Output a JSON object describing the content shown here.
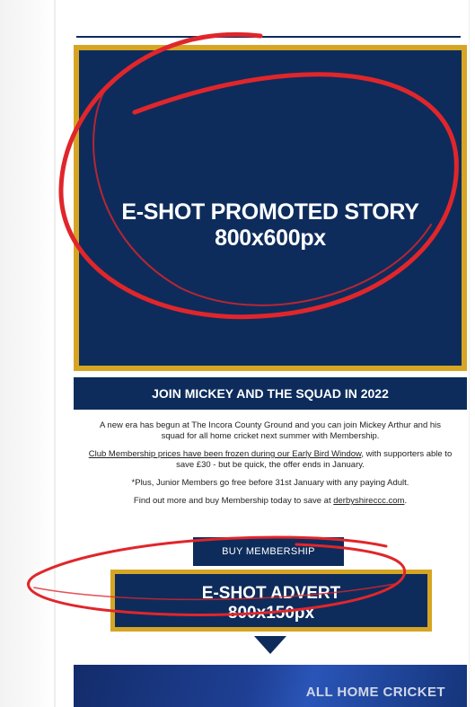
{
  "promo": {
    "line1": "E-SHOT PROMOTED STORY",
    "line2": "800x600px"
  },
  "band": {
    "title": "JOIN MICKEY AND THE SQUAD IN 2022"
  },
  "body": {
    "p1": "A new era has begun at The Incora County Ground and you can join Mickey Arthur and his squad for all home cricket next summer with Membership.",
    "p2_link": "Club Membership prices have been frozen during our Early Bird Window",
    "p2_rest": ", with supporters able to save £30 - but be quick, the offer ends in January.",
    "p3": "*Plus, Junior Members go free before 31st January with any paying Adult.",
    "p4_pre": "Find out more and buy Membership today to save at ",
    "p4_link": "derbyshireccc.com",
    "p4_post": "."
  },
  "buttons": {
    "buy": "BUY MEMBERSHIP"
  },
  "advert": {
    "line1": "E-SHOT ADVERT",
    "line2": "800x150px"
  },
  "banner": {
    "text": "ALL HOME CRICKET"
  },
  "colors": {
    "navy": "#0d2c5c",
    "gold": "#d6a524",
    "annotation_red": "#e0262b"
  },
  "icons": {
    "chevron": "chevron-down-icon"
  }
}
